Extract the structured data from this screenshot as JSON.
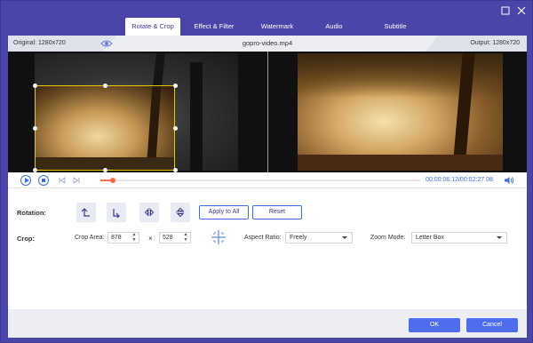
{
  "window": {
    "tabs": [
      {
        "label": "Rotate & Crop",
        "active": true
      },
      {
        "label": "Effect & Filter",
        "active": false
      },
      {
        "label": "Watermark",
        "active": false
      },
      {
        "label": "Audio",
        "active": false
      },
      {
        "label": "Subtitle",
        "active": false
      }
    ],
    "maximize_icon": "maximize-icon",
    "close_icon": "close-icon"
  },
  "infobar": {
    "original": "Original: 1280x720",
    "filename": "gopro-video.mp4",
    "output": "Output: 1280x720"
  },
  "playback": {
    "time": "00:00:06.12/00:02:27.08",
    "progress": 0.04,
    "accent": "#3d6fe0",
    "progress_color": "#ff6a4a"
  },
  "rotation": {
    "label": "Rotation:",
    "apply_all": "Apply to All",
    "reset": "Reset"
  },
  "crop": {
    "label": "Crop:",
    "area_label": "Crop Area:",
    "width": "878",
    "times": "×",
    "height": "528",
    "aspect_label": "Aspect Ratio:",
    "aspect_value": "Freely",
    "zoom_label": "Zoom Mode:",
    "zoom_value": "Letter Box"
  },
  "footer": {
    "ok": "OK",
    "cancel": "Cancel"
  },
  "colors": {
    "titlebar": "#4a45a8",
    "primary_button": "#4e6cf0",
    "crop_border": "#e6c800"
  }
}
